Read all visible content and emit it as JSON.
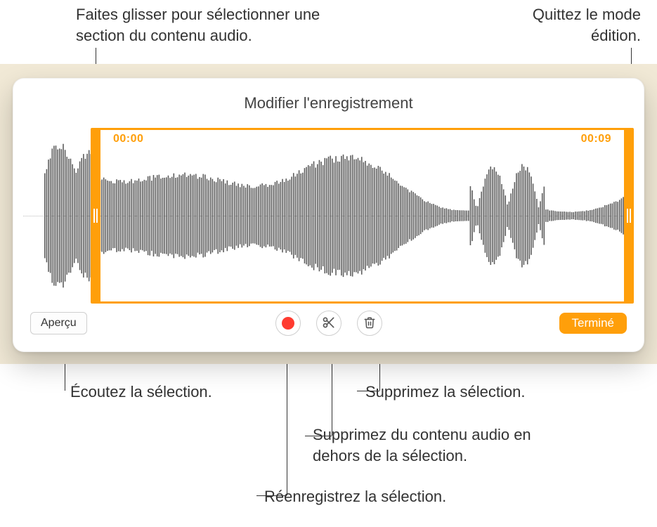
{
  "callouts": {
    "dragSelect": "Faites glisser pour sélectionner\nune section du contenu audio.",
    "exitEdit": "Quittez le mode\nédition.",
    "listen": "Écoutez la sélection.",
    "deleteSel": "Supprimez la sélection.",
    "deleteOutside": "Supprimez du contenu audio\nen dehors de la sélection.",
    "rerecord": "Réenregistrez la sélection."
  },
  "panel": {
    "title": "Modifier l'enregistrement",
    "timeStart": "00:00",
    "timeEnd": "00:09"
  },
  "toolbar": {
    "preview": "Aperçu",
    "done": "Terminé"
  },
  "icons": {
    "record": "record-icon",
    "scissors": "scissors-icon",
    "trash": "trash-icon"
  },
  "colors": {
    "accent": "#ff9f0a",
    "recordDot": "#ff3b30"
  }
}
